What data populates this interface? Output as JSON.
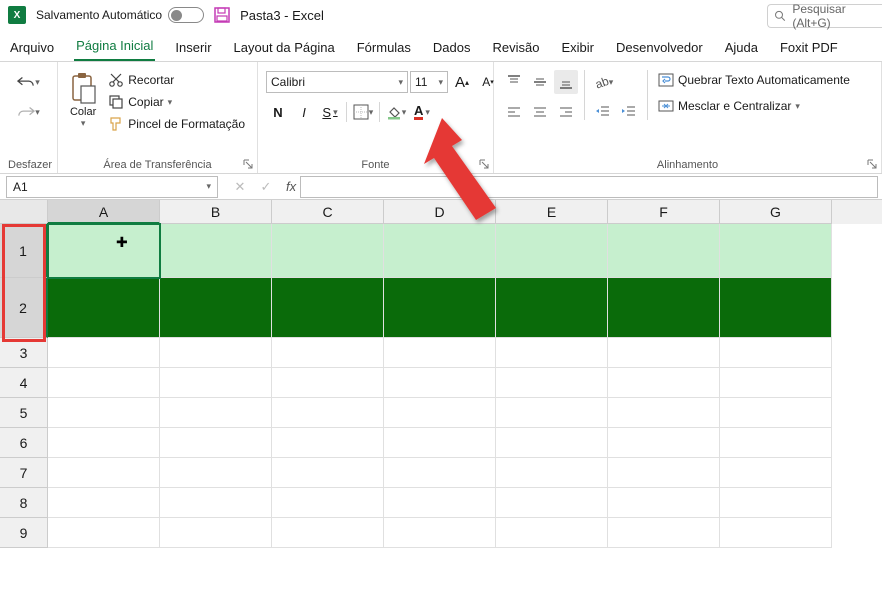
{
  "title_bar": {
    "autosave_label": "Salvamento Automático",
    "doc_title": "Pasta3  -  Excel",
    "search_placeholder": "Pesquisar (Alt+G)"
  },
  "tabs": {
    "arquivo": "Arquivo",
    "inicio": "Página Inicial",
    "inserir": "Inserir",
    "layout": "Layout da Página",
    "formulas": "Fórmulas",
    "dados": "Dados",
    "revisao": "Revisão",
    "exibir": "Exibir",
    "desenvolvedor": "Desenvolvedor",
    "ajuda": "Ajuda",
    "foxit": "Foxit PDF"
  },
  "ribbon": {
    "desfazer": "Desfazer",
    "colar": "Colar",
    "recortar": "Recortar",
    "copiar": "Copiar",
    "pincel": "Pincel de Formatação",
    "area_transferencia": "Área de Transferência",
    "font_name": "Calibri",
    "font_size": "11",
    "fonte": "Fonte",
    "quebrar": "Quebrar Texto Automaticamente",
    "mesclar": "Mesclar e Centralizar",
    "alinhamento": "Alinhamento",
    "bold": "N",
    "italic": "I",
    "underline": "S",
    "increase_font": "A",
    "decrease_font": "A"
  },
  "namebox": {
    "ref": "A1"
  },
  "sheet": {
    "cols": [
      "A",
      "B",
      "C",
      "D",
      "E",
      "F",
      "G"
    ],
    "rows": [
      "1",
      "2",
      "3",
      "4",
      "5",
      "6",
      "7",
      "8",
      "9"
    ]
  }
}
